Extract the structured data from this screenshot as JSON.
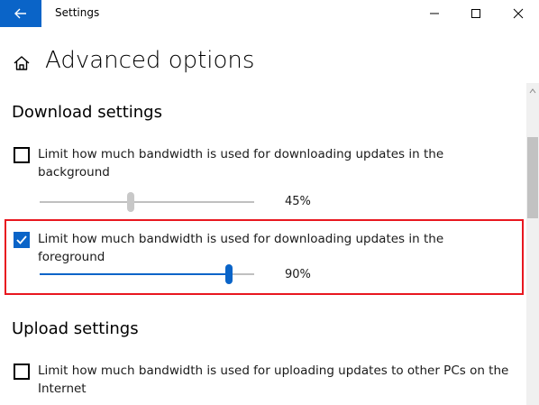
{
  "window": {
    "title": "Settings",
    "back_icon": "arrow-left-icon",
    "minimize_icon": "minimize-icon",
    "maximize_icon": "maximize-icon",
    "close_icon": "close-icon"
  },
  "page": {
    "title": "Advanced options",
    "home_icon": "home-icon"
  },
  "download": {
    "heading": "Download settings",
    "background": {
      "checked": false,
      "label": "Limit how much bandwidth is used for downloading updates in the background",
      "value_label": "45%",
      "level": 0.45
    },
    "foreground": {
      "checked": true,
      "label": "Limit how much bandwidth is used for downloading updates in the foreground",
      "value_label": "90%",
      "level": 0.9
    }
  },
  "upload": {
    "heading": "Upload settings",
    "other_pcs": {
      "checked": false,
      "label": "Limit how much bandwidth is used for uploading updates to other PCs on the Internet"
    }
  },
  "colors": {
    "accent": "#0a64c8",
    "highlight_border": "#e8171f",
    "slider_inactive": "#c0c0c0",
    "slider_disabled_thumb": "#c8c8c8"
  }
}
